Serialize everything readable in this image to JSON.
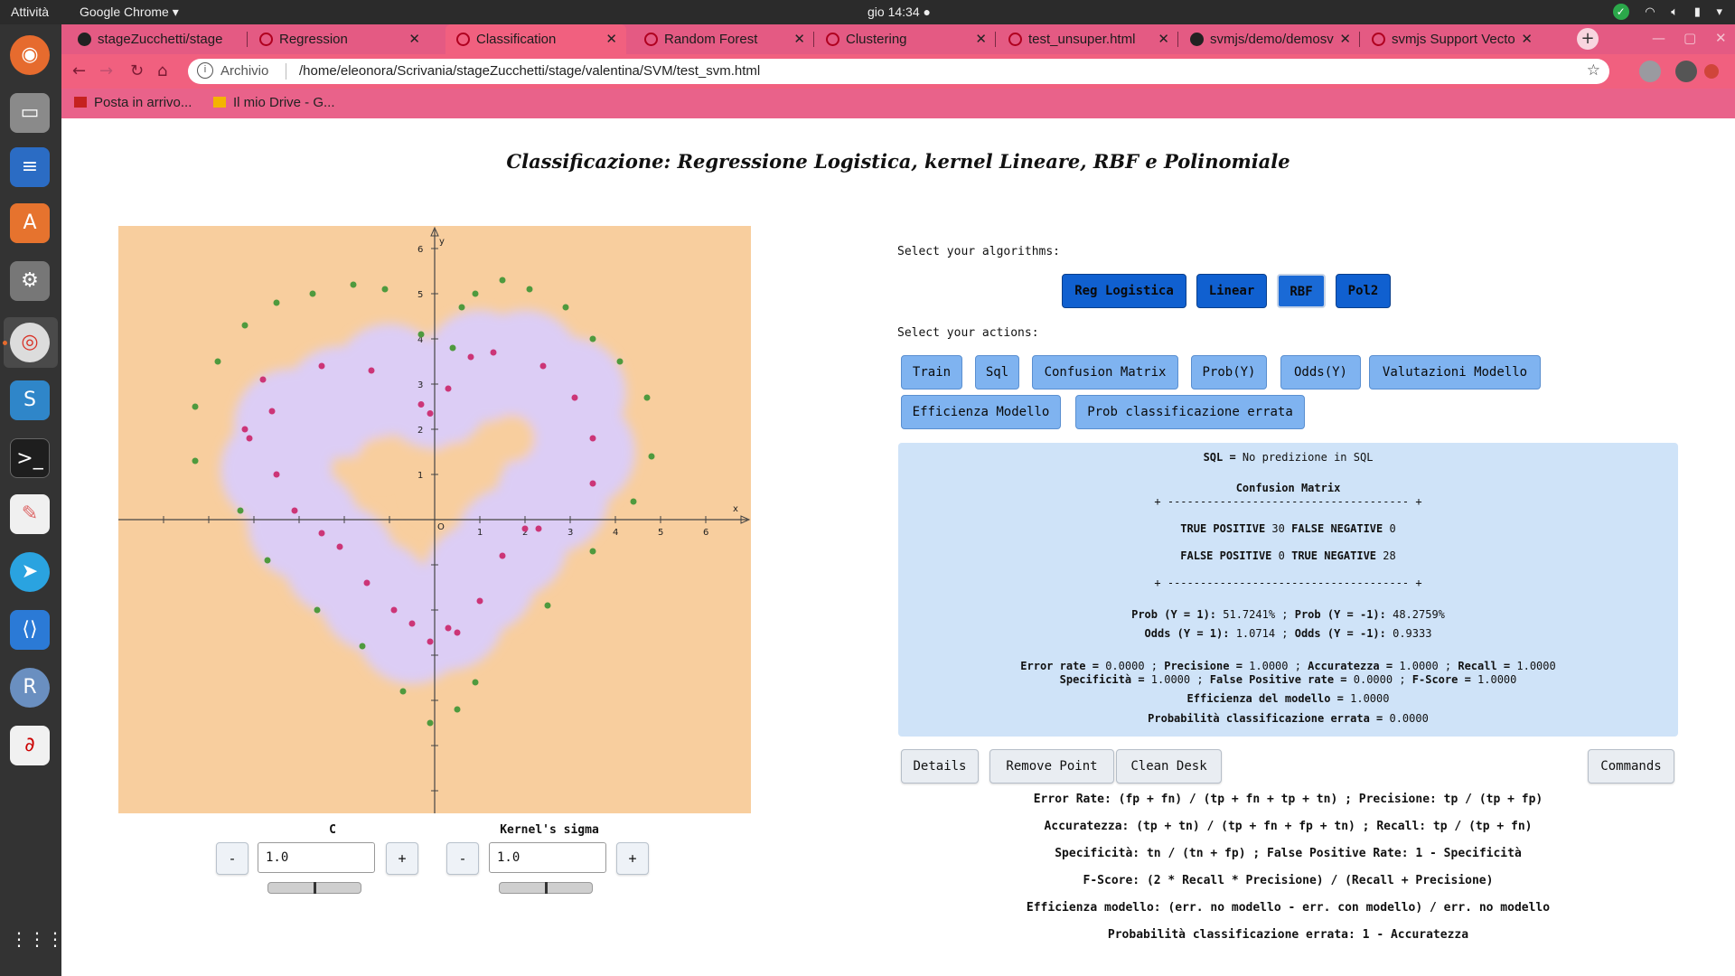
{
  "topbar": {
    "activities": "Attività",
    "app_menu": "Google Chrome ▾",
    "clock": "gio 14:34 ●"
  },
  "browser": {
    "tabs": [
      {
        "label": "stageZucchetti/stage",
        "icon": "github-icon",
        "active": false
      },
      {
        "label": "Regression",
        "icon": "svmjs-icon",
        "active": false
      },
      {
        "label": "Classification",
        "icon": "svmjs-icon",
        "active": true
      },
      {
        "label": "Random Forest",
        "icon": "svmjs-icon",
        "active": false
      },
      {
        "label": "Clustering",
        "icon": "svmjs-icon",
        "active": false
      },
      {
        "label": "test_unsuper.html",
        "icon": "svmjs-icon",
        "active": false
      },
      {
        "label": "svmjs/demo/demosv",
        "icon": "github-icon",
        "active": false
      },
      {
        "label": "svmjs Support Vecto",
        "icon": "svmjs-icon",
        "active": false
      }
    ],
    "address_label": "Archivio",
    "url": "/home/eleonora/Scrivania/stageZucchetti/stage/valentina/SVM/test_svm.html",
    "bookmarks": [
      "Posta in arrivo...",
      "Il mio Drive - G..."
    ]
  },
  "page": {
    "title": "Classificazione: Regressione Logistica, kernel Lineare, RBF e Polinomiale",
    "controls": {
      "c": {
        "label": "C",
        "value": "1.0",
        "minus": "-",
        "plus": "+",
        "slider_fraction": 0.5
      },
      "sigma": {
        "label": "Kernel's sigma",
        "value": "1.0",
        "minus": "-",
        "plus": "+",
        "slider_fraction": 0.5
      }
    },
    "algorithms_label": "Select your algorithms:",
    "algorithms": [
      "Reg Logistica",
      "Linear",
      "RBF",
      "Pol2"
    ],
    "selected_algorithm": "RBF",
    "actions_label": "Select your actions:",
    "actions": [
      "Train",
      "Sql",
      "Confusion Matrix",
      "Prob(Y)",
      "Odds(Y)",
      "Valutazioni Modello",
      "Efficienza Modello",
      "Prob classificazione errata"
    ],
    "results": {
      "sql_key": "SQL =",
      "sql_val": " No predizione in SQL",
      "cm_title": "Confusion Matrix",
      "cm_border": "+ ------------------------------------- +",
      "tp_key": "TRUE POSITIVE",
      "tp_val": " 30 ",
      "fn_key": "FALSE NEGATIVE",
      "fn_val": " 0",
      "fp_key": "FALSE POSITIVE",
      "fp_val": " 0 ",
      "tn_key": "TRUE NEGATIVE",
      "tn_val": " 28",
      "prob_pos_key": "Prob (Y = 1):",
      "prob_pos_val": " 51.7241% ; ",
      "prob_neg_key": "Prob (Y = -1):",
      "prob_neg_val": " 48.2759%",
      "odds_pos_key": "Odds (Y = 1):",
      "odds_pos_val": " 1.0714 ; ",
      "odds_neg_key": "Odds (Y = -1):",
      "odds_neg_val": " 0.9333",
      "err_key": "Error rate =",
      "err_val": " 0.0000 ; ",
      "prec_key": "Precisione =",
      "prec_val": " 1.0000 ; ",
      "acc_key": "Accuratezza =",
      "acc_val": " 1.0000 ; ",
      "rec_key": "Recall =",
      "rec_val": " 1.0000",
      "spec_key": "Specificità =",
      "spec_val": " 1.0000 ; ",
      "fpr_key": "False Positive rate =",
      "fpr_val": " 0.0000 ; ",
      "fs_key": "F-Score =",
      "fs_val": " 1.0000",
      "eff_key": "Efficienza del modello =",
      "eff_val": " 1.0000",
      "perr_key": "Probabilità classificazione errata =",
      "perr_val": " 0.0000"
    },
    "bottom_buttons": [
      "Details",
      "Remove Point",
      "Clean Desk",
      "Commands"
    ],
    "formulas": [
      "Error Rate: (fp + fn) / (tp + fn + tp + tn) ; Precisione: tp / (tp + fp)",
      "Accuratezza: (tp + tn) / (tp + fn + fp + tn) ; Recall: tp / (tp + fn)",
      "Specificità: tn / (tn + fp) ; False Positive Rate: 1 - Specificità",
      "F-Score: (2 * Recall * Precisione) / (Recall + Precisione)",
      "Efficienza modello: (err. no modello - err. con modello) / err. no modello",
      "Probabilità classificazione errata: 1 - Accuratezza"
    ]
  },
  "chart_data": {
    "type": "scatter",
    "xlabel": "x",
    "ylabel": "y",
    "xlim": [
      -7,
      7
    ],
    "ylim": [
      -6.5,
      6.5
    ],
    "x_ticks": [
      1,
      2,
      3,
      4,
      5,
      6
    ],
    "y_ticks": [
      1,
      2,
      3,
      4,
      5,
      6
    ],
    "origin_label": "O",
    "colors": {
      "background": "#f8ce9e",
      "decision_region": "#dccdf5",
      "positive": "#cc3577",
      "negative": "#4f9a3e",
      "axis": "#444444"
    },
    "series": [
      {
        "values": [
          [
            -3.8,
            3.1
          ],
          [
            -3.6,
            2.4
          ],
          [
            -4.2,
            2.0
          ],
          [
            -4.1,
            1.8
          ],
          [
            -3.5,
            1.0
          ],
          [
            -3.1,
            0.2
          ],
          [
            -2.5,
            3.4
          ],
          [
            -1.4,
            3.3
          ],
          [
            -0.3,
            2.55
          ],
          [
            -0.1,
            2.35
          ],
          [
            0.3,
            2.9
          ],
          [
            0.8,
            3.6
          ],
          [
            1.3,
            3.7
          ],
          [
            2.4,
            3.4
          ],
          [
            3.1,
            2.7
          ],
          [
            3.5,
            1.8
          ],
          [
            3.5,
            0.8
          ],
          [
            -2.5,
            -0.3
          ],
          [
            -2.1,
            -0.6
          ],
          [
            -1.5,
            -1.4
          ],
          [
            -0.9,
            -2.0
          ],
          [
            -0.5,
            -2.3
          ],
          [
            -0.1,
            -2.7
          ],
          [
            0.3,
            -2.4
          ],
          [
            0.5,
            -2.5
          ],
          [
            1.0,
            -1.8
          ],
          [
            1.5,
            -0.8
          ],
          [
            2.0,
            -0.2
          ],
          [
            2.3,
            -0.2
          ]
        ]
      },
      {
        "values": [
          [
            -4.8,
            3.5
          ],
          [
            -4.2,
            4.3
          ],
          [
            -3.5,
            4.8
          ],
          [
            -2.7,
            5.0
          ],
          [
            -1.8,
            5.2
          ],
          [
            -1.1,
            5.1
          ],
          [
            -0.3,
            4.1
          ],
          [
            0.4,
            3.8
          ],
          [
            0.6,
            4.7
          ],
          [
            0.9,
            5.0
          ],
          [
            1.5,
            5.3
          ],
          [
            2.1,
            5.1
          ],
          [
            2.9,
            4.7
          ],
          [
            3.5,
            4.0
          ],
          [
            4.1,
            3.5
          ],
          [
            4.7,
            2.7
          ],
          [
            4.8,
            1.4
          ],
          [
            4.4,
            0.4
          ],
          [
            -5.3,
            2.5
          ],
          [
            -5.3,
            1.3
          ],
          [
            -4.3,
            0.2
          ],
          [
            -3.7,
            -0.9
          ],
          [
            -2.6,
            -2.0
          ],
          [
            -1.6,
            -2.8
          ],
          [
            -0.7,
            -3.8
          ],
          [
            -0.1,
            -4.5
          ],
          [
            0.5,
            -4.2
          ],
          [
            0.9,
            -3.6
          ],
          [
            2.5,
            -1.9
          ],
          [
            3.5,
            -0.7
          ]
        ]
      }
    ],
    "decision_region_centers": [
      [
        -2.1,
        2.6
      ],
      [
        -3.2,
        2.1
      ],
      [
        -3.5,
        1.1
      ],
      [
        -2.9,
        -0.1
      ],
      [
        -2.1,
        -0.9
      ],
      [
        -1.3,
        -1.7
      ],
      [
        -0.5,
        -2.4
      ],
      [
        0.3,
        -2.1
      ],
      [
        1.0,
        -1.3
      ],
      [
        1.7,
        -0.5
      ],
      [
        2.6,
        0.5
      ],
      [
        3.2,
        1.5
      ],
      [
        3.0,
        2.8
      ],
      [
        2.0,
        3.4
      ],
      [
        1.0,
        3.4
      ],
      [
        0.0,
        2.8
      ],
      [
        -1.0,
        3.1
      ]
    ]
  }
}
